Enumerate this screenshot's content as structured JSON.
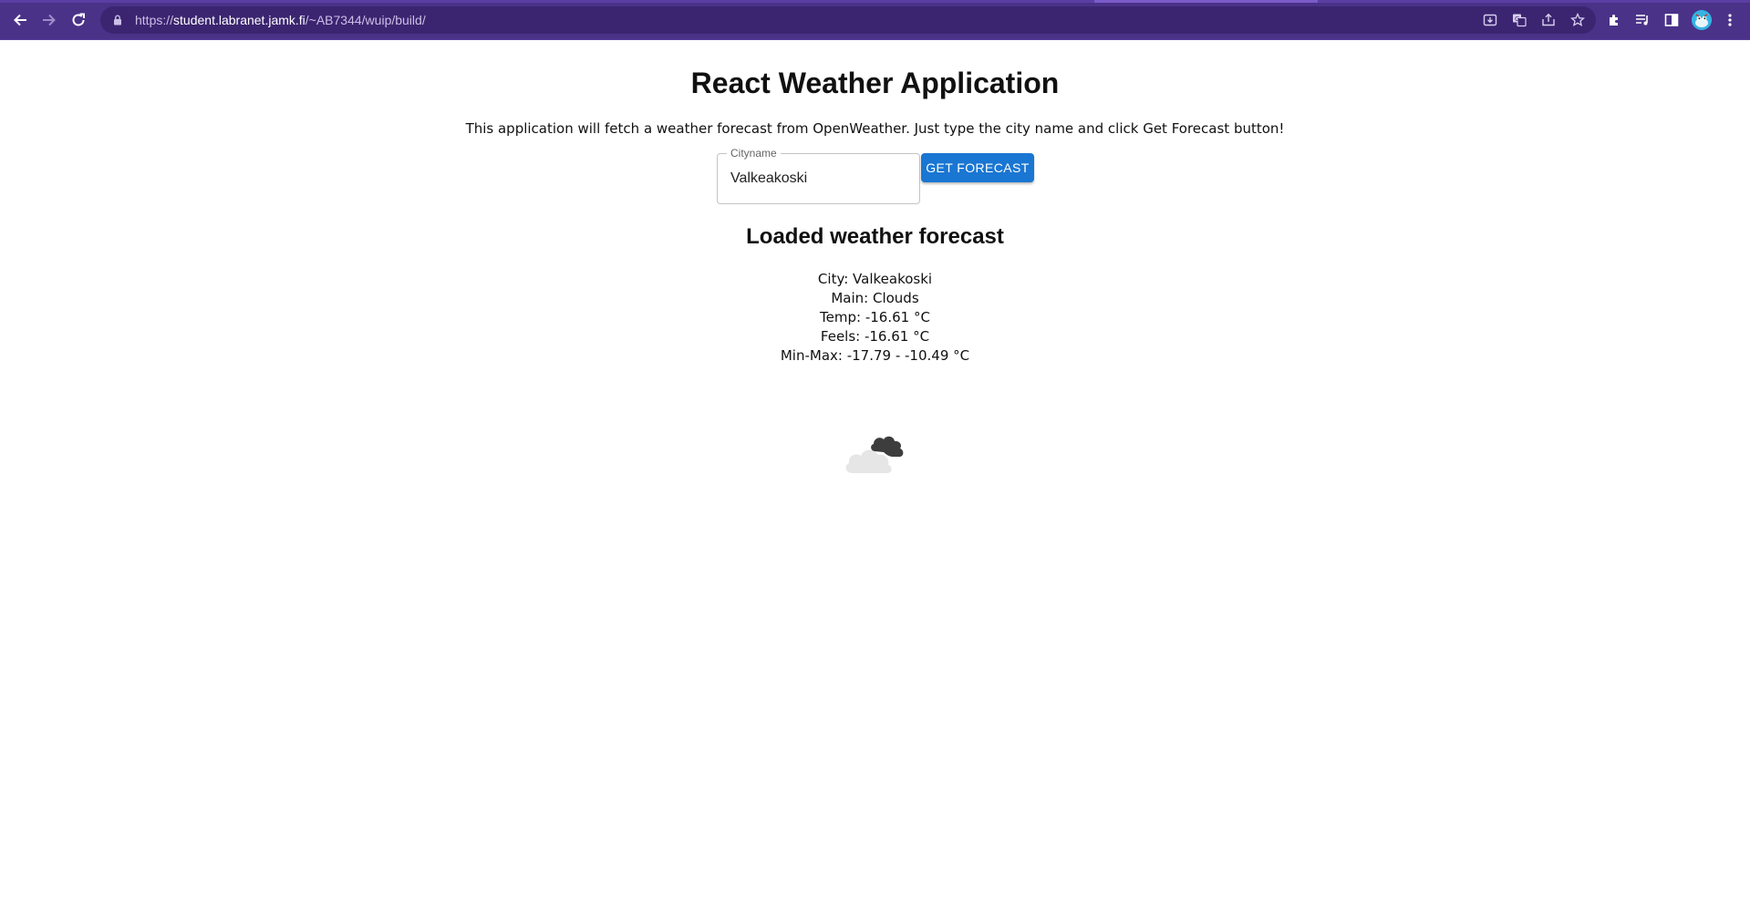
{
  "browser": {
    "url_scheme": "https://",
    "url_host": "student.labranet.jamk.fi",
    "url_path": "/~AB7344/wuip/build/",
    "theme_color": "#4a3288"
  },
  "app": {
    "title": "React Weather Application",
    "intro": "This application will fetch a weather forecast from OpenWeather. Just type the city name and click Get Forecast button!",
    "city_field": {
      "label": "Cityname",
      "value": "Valkeakoski"
    },
    "button_label": "GET FORECAST",
    "accent_color": "#1976d2"
  },
  "forecast": {
    "heading": "Loaded weather forecast",
    "city": "City: Valkeakoski",
    "main": "Main: Clouds",
    "temp": "Temp: -16.61 °C",
    "feels": "Feels: -16.61 °C",
    "minmax": "Min-Max: -17.79 - -10.49 °C",
    "icon": "broken-clouds-icon"
  }
}
